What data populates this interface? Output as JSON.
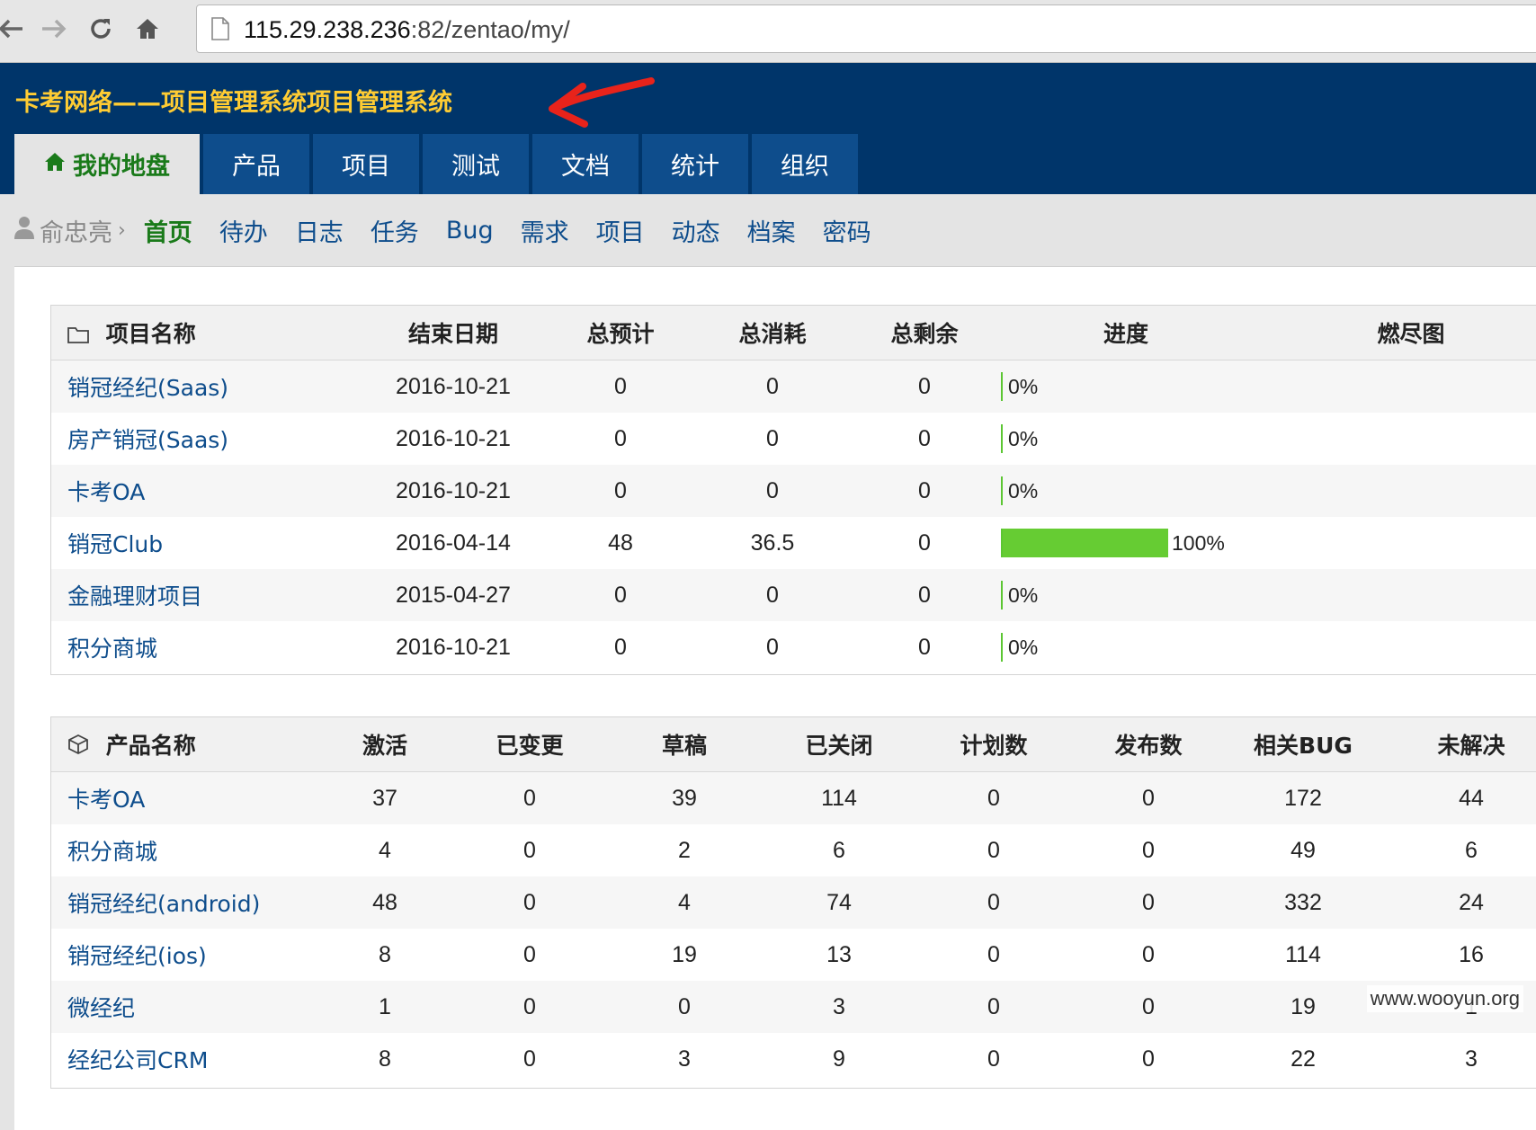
{
  "browser": {
    "url_host": "115.29.238.236",
    "url_rest": ":82/zentao/my/"
  },
  "header": {
    "title": "卡考网络——项目管理系统项目管理系统",
    "nav": [
      {
        "label": "我的地盘",
        "icon": "home-icon",
        "active": true
      },
      {
        "label": "产品"
      },
      {
        "label": "项目"
      },
      {
        "label": "测试"
      },
      {
        "label": "文档"
      },
      {
        "label": "统计"
      },
      {
        "label": "组织"
      }
    ]
  },
  "subnav": {
    "user": "俞忠亮",
    "items": [
      "首页",
      "待办",
      "日志",
      "任务",
      "Bug",
      "需求",
      "项目",
      "动态",
      "档案",
      "密码"
    ],
    "active_index": 0
  },
  "projects": {
    "headers": [
      "项目名称",
      "结束日期",
      "总预计",
      "总消耗",
      "总剩余",
      "进度",
      "燃尽图"
    ],
    "rows": [
      {
        "name": "销冠经纪(Saas)",
        "end": "2016-10-21",
        "estimate": "0",
        "consumed": "0",
        "left": "0",
        "progress": 0,
        "progress_label": "0%"
      },
      {
        "name": "房产销冠(Saas)",
        "end": "2016-10-21",
        "estimate": "0",
        "consumed": "0",
        "left": "0",
        "progress": 0,
        "progress_label": "0%"
      },
      {
        "name": "卡考OA",
        "end": "2016-10-21",
        "estimate": "0",
        "consumed": "0",
        "left": "0",
        "progress": 0,
        "progress_label": "0%"
      },
      {
        "name": "销冠Club",
        "end": "2016-04-14",
        "estimate": "48",
        "consumed": "36.5",
        "left": "0",
        "progress": 100,
        "progress_label": "100%"
      },
      {
        "name": "金融理财项目",
        "end": "2015-04-27",
        "estimate": "0",
        "consumed": "0",
        "left": "0",
        "progress": 0,
        "progress_label": "0%"
      },
      {
        "name": "积分商城",
        "end": "2016-10-21",
        "estimate": "0",
        "consumed": "0",
        "left": "0",
        "progress": 0,
        "progress_label": "0%"
      }
    ]
  },
  "products": {
    "headers": [
      "产品名称",
      "激活",
      "已变更",
      "草稿",
      "已关闭",
      "计划数",
      "发布数",
      "相关BUG",
      "未解决"
    ],
    "rows": [
      {
        "name": "卡考OA",
        "cells": [
          "37",
          "0",
          "39",
          "114",
          "0",
          "0",
          "172",
          "44"
        ]
      },
      {
        "name": "积分商城",
        "cells": [
          "4",
          "0",
          "2",
          "6",
          "0",
          "0",
          "49",
          "6"
        ]
      },
      {
        "name": "销冠经纪(android)",
        "cells": [
          "48",
          "0",
          "4",
          "74",
          "0",
          "0",
          "332",
          "24"
        ]
      },
      {
        "name": "销冠经纪(ios)",
        "cells": [
          "8",
          "0",
          "19",
          "13",
          "0",
          "0",
          "114",
          "16"
        ]
      },
      {
        "name": "微经纪",
        "cells": [
          "1",
          "0",
          "0",
          "3",
          "0",
          "0",
          "19",
          "1"
        ]
      },
      {
        "name": "经纪公司CRM",
        "cells": [
          "8",
          "0",
          "3",
          "9",
          "0",
          "0",
          "22",
          "3"
        ]
      }
    ]
  },
  "watermark": "www.wooyun.org",
  "colors": {
    "header_bg": "#00356a",
    "title": "#ffcc33",
    "nav_tab": "#0e4d8c",
    "active_green": "#1a7a1a",
    "link_blue": "#0e4d8c",
    "progress_green": "#66cc33",
    "annotation_red": "#e8231b"
  }
}
